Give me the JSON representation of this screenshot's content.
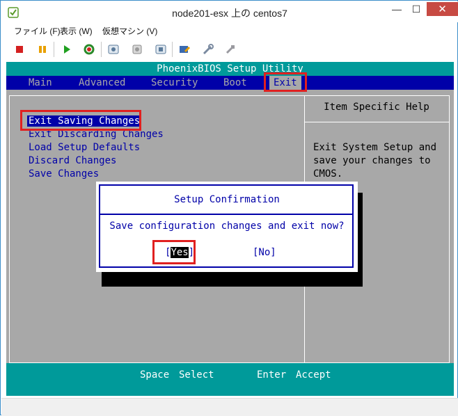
{
  "window": {
    "title": "node201-esx 上の centos7",
    "minimize": "—",
    "maximize": "☐",
    "close": "✕"
  },
  "menu": [
    "ファイル (F)",
    "表示 (W)",
    "仮想マシン (V)"
  ],
  "toolbar": {
    "icons": [
      "stop-icon",
      "pause-icon",
      "play-icon",
      "reset-icon",
      "snapshot-icon",
      "revert-snapshot-icon",
      "snapshot-manager-icon",
      "console-edit-icon",
      "settings-icon",
      "tools-icon"
    ],
    "colors": {
      "stop": "#d42020",
      "pause": "#e8a000",
      "play": "#20a020",
      "reset": "#2a8a2a"
    }
  },
  "bios": {
    "title": "PhoenixBIOS Setup Utility",
    "tabs": [
      "Main",
      "Advanced",
      "Security",
      "Boot",
      "Exit"
    ],
    "active_tab": "Exit",
    "options": [
      "Exit Saving Changes",
      "Exit Discarding Changes",
      "Load Setup Defaults",
      "Discard Changes",
      "Save Changes"
    ],
    "help_title": "Item Specific Help",
    "help_lines": [
      "Exit System Setup and",
      "save your changes to",
      "CMOS."
    ],
    "footer": {
      "key1": "Space",
      "desc1": "Select",
      "key2": "Enter",
      "desc2": "Accept"
    },
    "colors": {
      "blue": "#0000a8",
      "cyan": "#009a9a",
      "gray": "#a8a8a8"
    }
  },
  "dialog": {
    "title": "Setup Confirmation",
    "message": "Save configuration changes and exit now?",
    "yes_open": "[",
    "yes_label": "Yes",
    "yes_close": "]",
    "no_label": "[No]"
  },
  "annotation_color": "#e02020"
}
